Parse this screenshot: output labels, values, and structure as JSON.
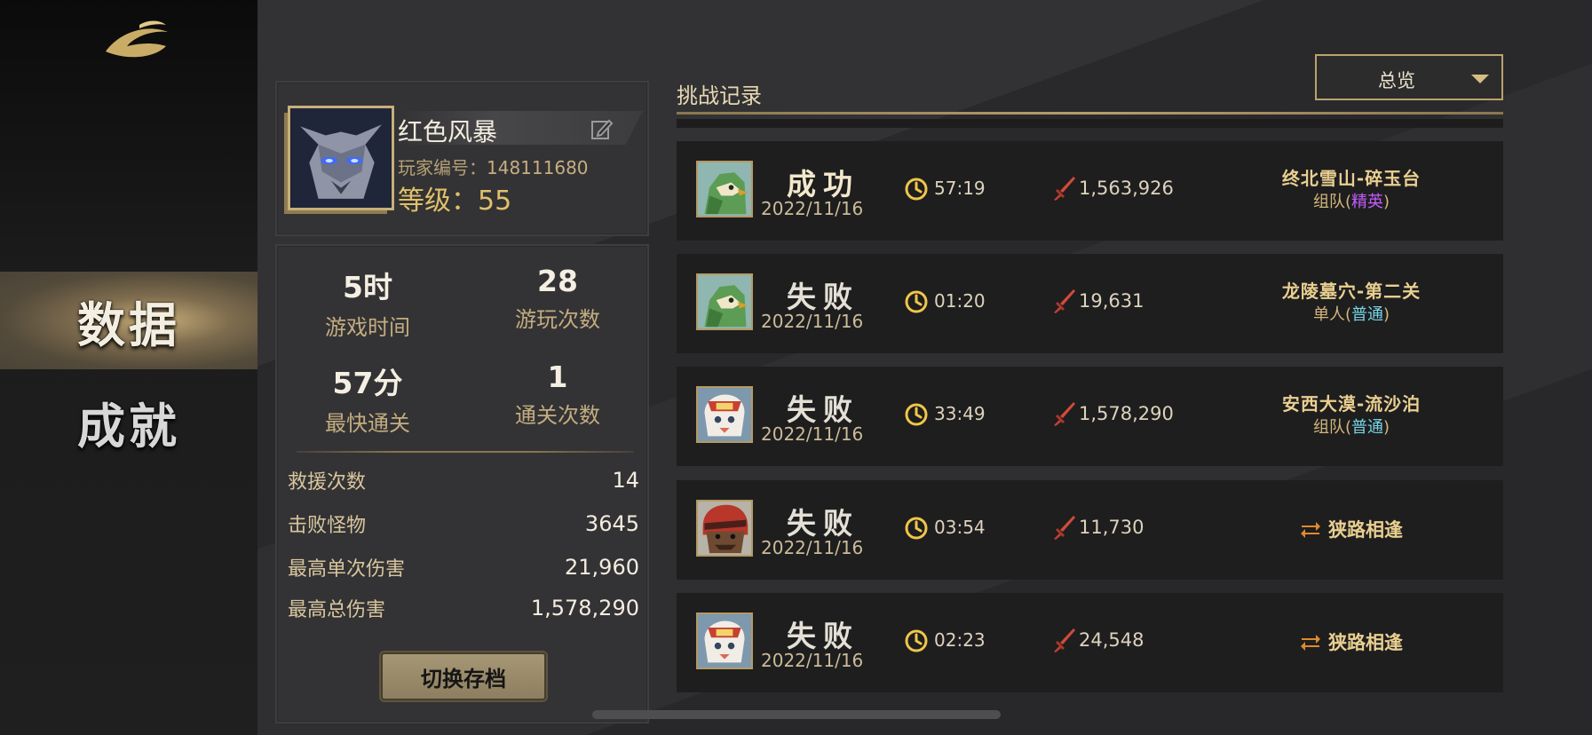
{
  "nav": {
    "items": [
      {
        "label": "数据",
        "active": true
      },
      {
        "label": "成就",
        "active": false
      }
    ]
  },
  "profile": {
    "name": "红色风暴",
    "id_label": "玩家编号：",
    "id_value": "148111680",
    "level_label": "等级：",
    "level_value": "55"
  },
  "stats": {
    "grid": [
      {
        "value": "5时",
        "label": "游戏时间"
      },
      {
        "value": "28",
        "label": "游玩次数"
      },
      {
        "value": "57分",
        "label": "最快通关"
      },
      {
        "value": "1",
        "label": "通关次数"
      }
    ],
    "rows": [
      {
        "label": "救援次数",
        "value": "14"
      },
      {
        "label": "击败怪物",
        "value": "3645"
      },
      {
        "label": "最高单次伤害",
        "value": "21,960"
      },
      {
        "label": "最高总伤害",
        "value": "1,578,290"
      }
    ],
    "switch_label": "切换存档"
  },
  "records": {
    "title": "挑战记录",
    "filter": "总览",
    "items": [
      {
        "icon": "green-bird-hero-icon",
        "result": "成功",
        "outcome": "win",
        "date": "2022/11/16",
        "time": "57:19",
        "damage": "1,563,926",
        "stage": "终北雪山-碎玉台",
        "mode_prefix": "组队",
        "mode_tag": "精英",
        "mode_kind": "elite"
      },
      {
        "icon": "green-bird-hero-icon",
        "result": "失败",
        "outcome": "lose",
        "date": "2022/11/16",
        "time": "01:20",
        "damage": "19,631",
        "stage": "龙陵墓穴-第二关",
        "mode_prefix": "单人",
        "mode_tag": "普通",
        "mode_kind": "normal"
      },
      {
        "icon": "lion-dance-hero-icon",
        "result": "失败",
        "outcome": "lose",
        "date": "2022/11/16",
        "time": "33:49",
        "damage": "1,578,290",
        "stage": "安西大漠-流沙泊",
        "mode_prefix": "组队",
        "mode_tag": "普通",
        "mode_kind": "normal"
      },
      {
        "icon": "red-hood-hero-icon",
        "result": "失败",
        "outcome": "lose",
        "date": "2022/11/16",
        "time": "03:54",
        "damage": "11,730",
        "pvp": "狭路相逢"
      },
      {
        "icon": "lion-dance-hero-icon",
        "result": "失败",
        "outcome": "lose",
        "date": "2022/11/16",
        "time": "02:23",
        "damage": "24,548",
        "pvp": "狭路相逢"
      }
    ]
  },
  "colors": {
    "gold": "#c7b07a",
    "elite": "#c45cff",
    "normal": "#77d4e6"
  }
}
